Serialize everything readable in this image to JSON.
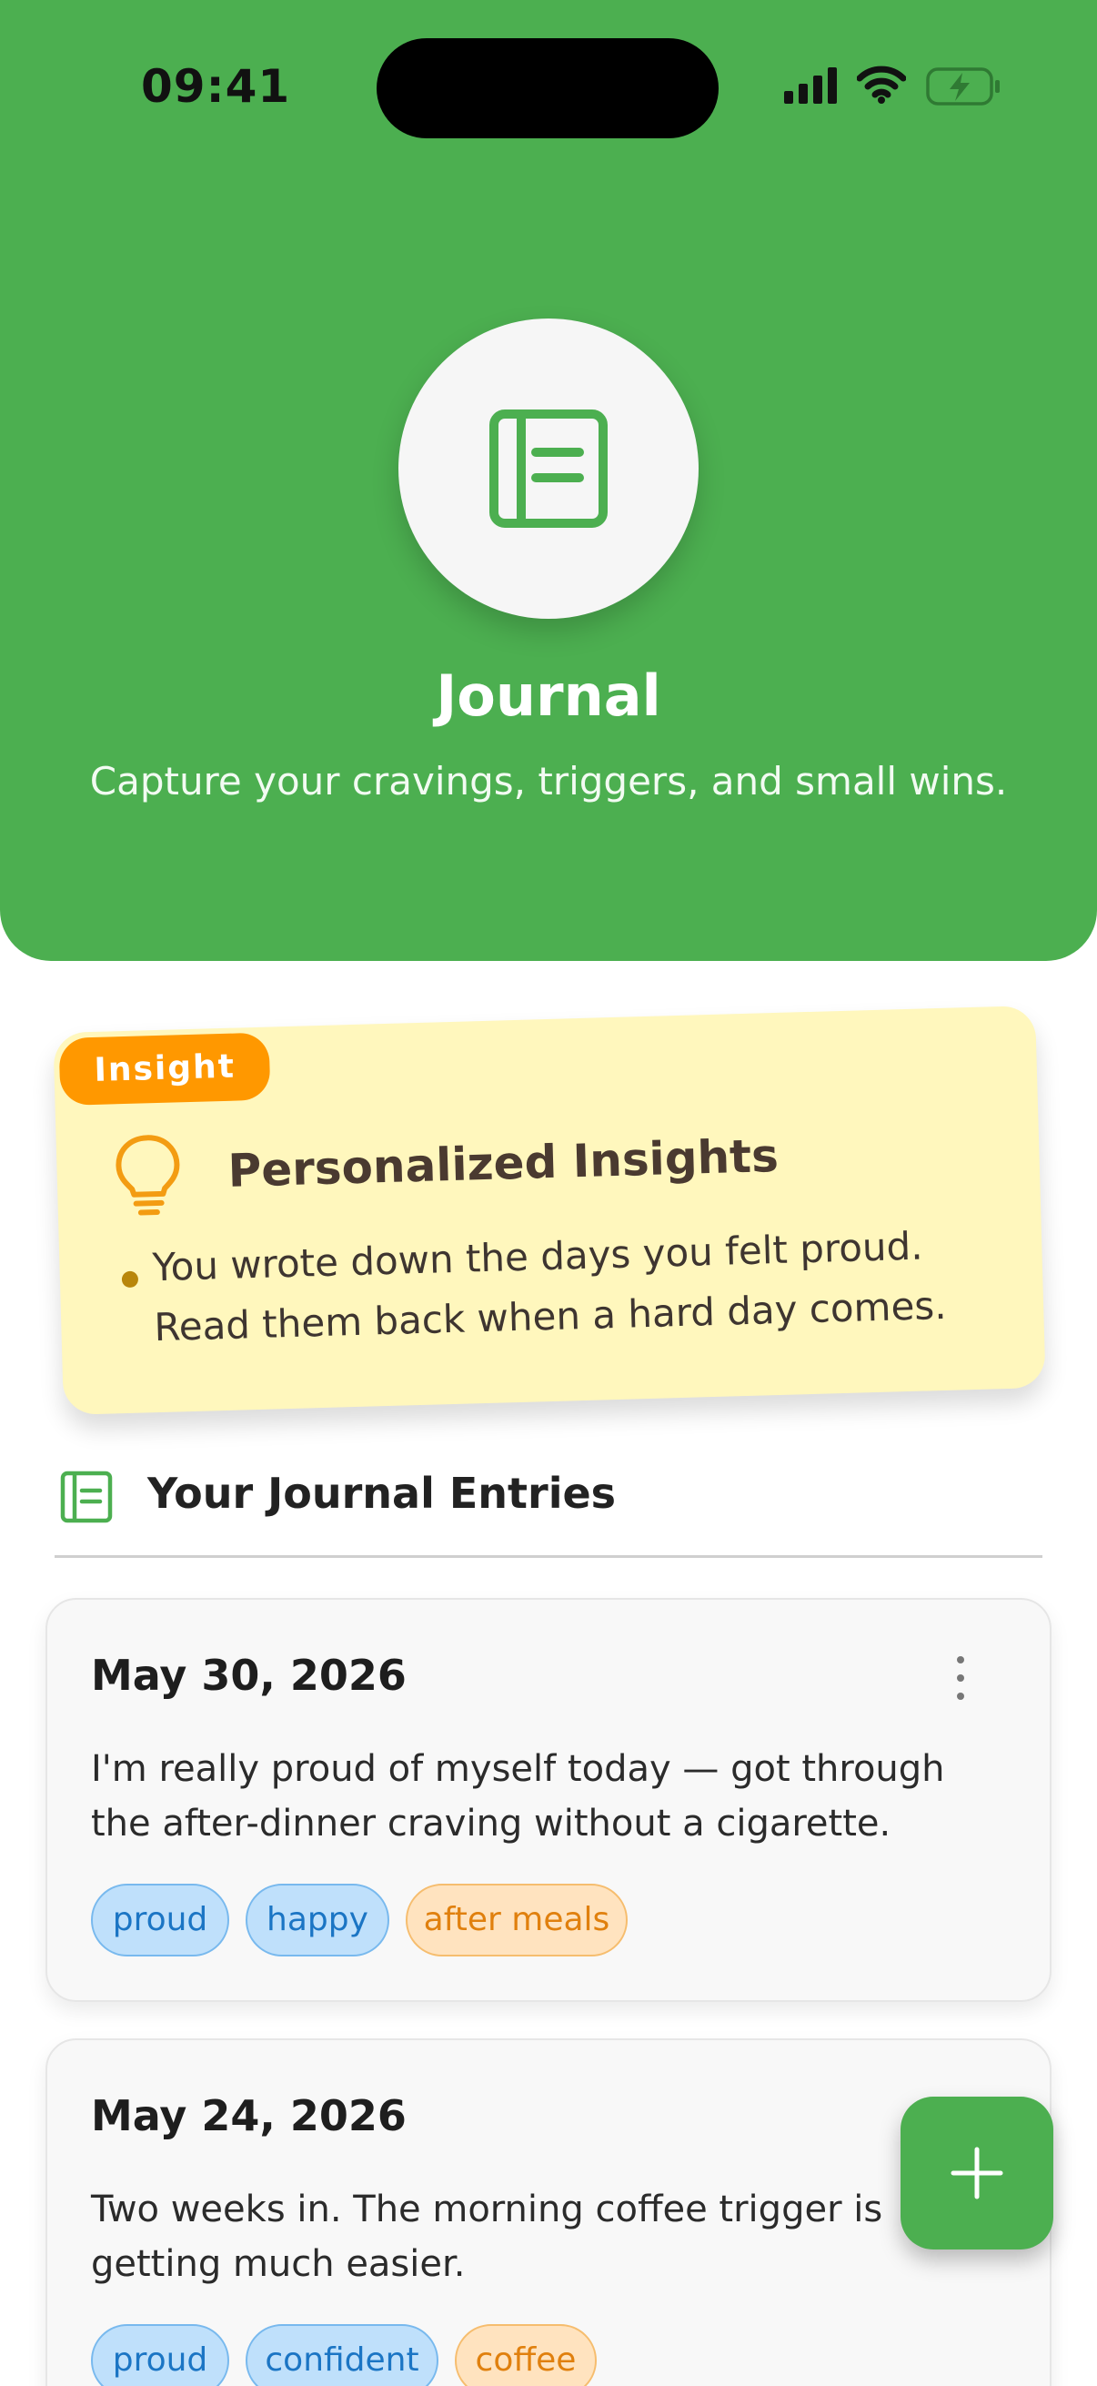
{
  "status_bar": {
    "time": "09:41",
    "icons": [
      "signal-icon",
      "wifi-icon",
      "battery-charging-icon"
    ]
  },
  "header": {
    "icon": "journal-icon",
    "title": "Journal",
    "subtitle": "Capture your cravings, triggers, and small wins."
  },
  "insight": {
    "badge": "Insight",
    "icon": "lightbulb-icon",
    "title": "Personalized Insights",
    "items": [
      "You wrote down the days you felt proud. Read them back when a hard day comes."
    ]
  },
  "entries_section": {
    "icon": "journal-icon",
    "title": "Your Journal Entries"
  },
  "entries": [
    {
      "date": "May 30, 2026",
      "text": "I'm really proud of myself today — got through the after-dinner craving without a cigarette.",
      "tags": [
        {
          "label": "proud",
          "kind": "mood"
        },
        {
          "label": "happy",
          "kind": "mood"
        },
        {
          "label": "after meals",
          "kind": "trigger"
        }
      ]
    },
    {
      "date": "May 24, 2026",
      "text": "Two weeks in. The morning coffee trigger is getting much easier.",
      "tags": [
        {
          "label": "proud",
          "kind": "mood"
        },
        {
          "label": "confident",
          "kind": "mood"
        },
        {
          "label": "coffee",
          "kind": "trigger"
        }
      ]
    }
  ],
  "fab": {
    "icon": "plus-icon"
  },
  "colors": {
    "primary": "#4caf50",
    "insight_bg": "#fff7bd",
    "insight_badge": "#ff9800",
    "mood_tag": "#bfe0fb",
    "trigger_tag": "#ffe3bf"
  }
}
